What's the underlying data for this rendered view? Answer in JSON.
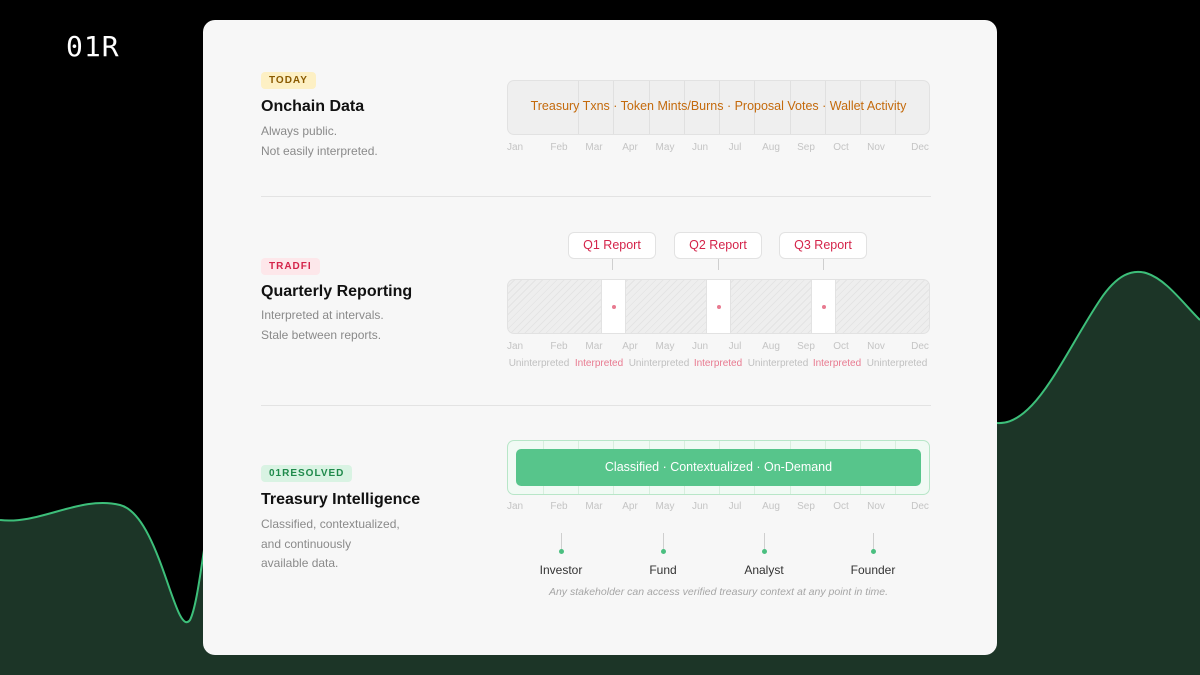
{
  "brand": {
    "logo_text": "01R"
  },
  "months": [
    "Jan",
    "Feb",
    "Mar",
    "Apr",
    "May",
    "Jun",
    "Jul",
    "Aug",
    "Sep",
    "Oct",
    "Nov",
    "Dec"
  ],
  "today": {
    "badge": "TODAY",
    "title": "Onchain Data",
    "desc_line1": "Always public.",
    "desc_line2": "Not easily interpreted.",
    "bar_label": "Treasury Txns · Token Mints/Burns · Proposal Votes · Wallet Activity"
  },
  "tradfi": {
    "badge": "TRADFI",
    "title": "Quarterly Reporting",
    "desc_line1": "Interpreted at intervals.",
    "desc_line2": "Stale between reports.",
    "reports": [
      "Q1 Report",
      "Q2 Report",
      "Q3 Report"
    ],
    "segment_labels": [
      "Uninterpreted",
      "Interpreted",
      "Uninterpreted",
      "Interpreted",
      "Uninterpreted",
      "Interpreted",
      "Uninterpreted"
    ]
  },
  "resolved": {
    "badge": "01RESOLVED",
    "title": "Treasury Intelligence",
    "desc_line1": "Classified, contextualized,",
    "desc_line2": "and continuously",
    "desc_line3": "available data.",
    "bar_label": "Classified · Contextualized · On-Demand",
    "stakeholders": [
      "Investor",
      "Fund",
      "Analyst",
      "Founder"
    ],
    "footnote": "Any stakeholder can access verified treasury context at any point in time."
  },
  "colors": {
    "accent_green": "#57c58b",
    "tradfi_red": "#d4244a",
    "today_orange": "#c46a0c",
    "wave_green": "#3dbf7a"
  }
}
